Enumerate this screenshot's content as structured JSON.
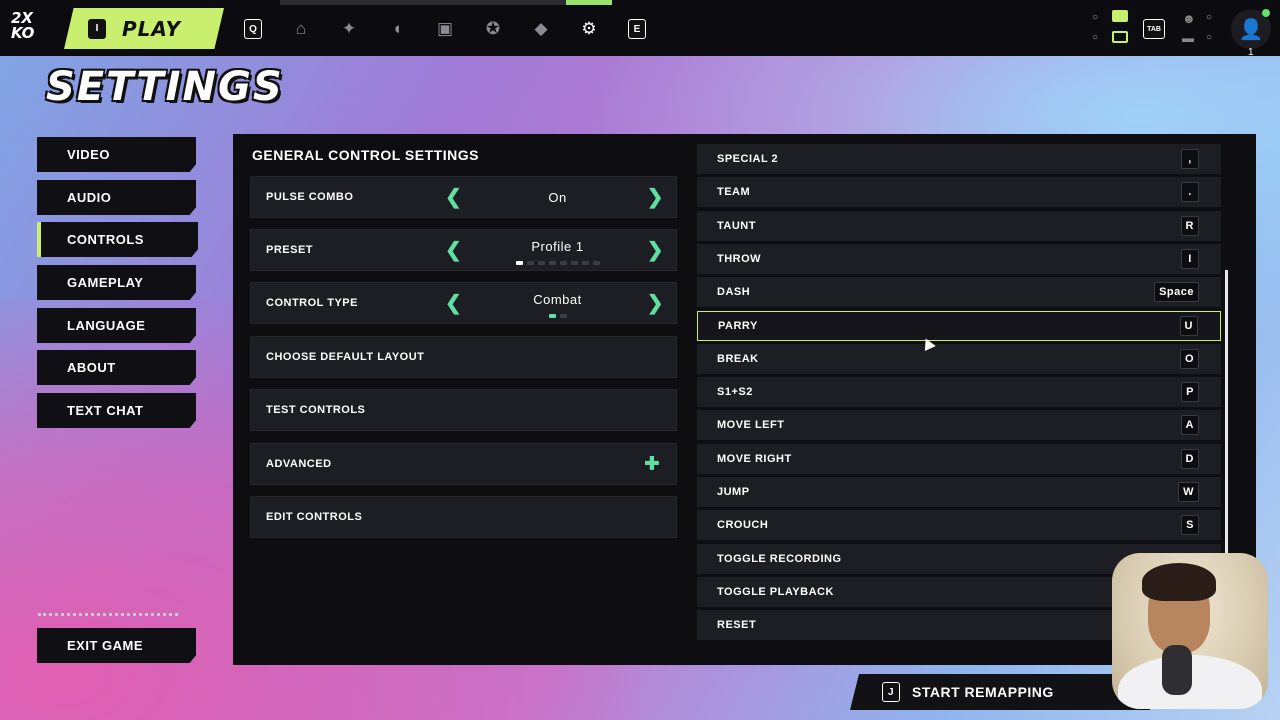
{
  "topbar": {
    "logo_text": "2X KO",
    "play_key": "I",
    "play_label": "PLAY",
    "nav_left_key": "Q",
    "nav_right_key": "E",
    "tab_key": "TAB",
    "avatar_count": "1",
    "nav_icons": [
      "store-icon",
      "crosshair-icon",
      "helmet-icon",
      "backpack-icon",
      "medal-icon",
      "graduation-cap-icon",
      "gear-icon"
    ]
  },
  "page_title": "SETTINGS",
  "sidebar": {
    "items": [
      {
        "label": "VIDEO"
      },
      {
        "label": "AUDIO"
      },
      {
        "label": "CONTROLS",
        "active": true
      },
      {
        "label": "GAMEPLAY"
      },
      {
        "label": "LANGUAGE"
      },
      {
        "label": "ABOUT"
      },
      {
        "label": "TEXT CHAT"
      }
    ],
    "exit_label": "EXIT GAME"
  },
  "general": {
    "title": "GENERAL CONTROL SETTINGS",
    "pulse_combo": {
      "label": "PULSE COMBO",
      "value": "On"
    },
    "preset": {
      "label": "PRESET",
      "value": "Profile 1",
      "page": 1,
      "pages": 8
    },
    "control_type": {
      "label": "CONTROL TYPE",
      "value": "Combat",
      "page": 1,
      "pages": 2
    },
    "choose_default_layout": "CHOOSE DEFAULT LAYOUT",
    "test_controls": "TEST CONTROLS",
    "advanced": "ADVANCED",
    "edit_controls": "EDIT CONTROLS"
  },
  "bindings": [
    {
      "action": "SPECIAL 2",
      "key": ","
    },
    {
      "action": "TEAM",
      "key": "."
    },
    {
      "action": "TAUNT",
      "key": "R"
    },
    {
      "action": "THROW",
      "key": "I"
    },
    {
      "action": "DASH",
      "key": "Space"
    },
    {
      "action": "PARRY",
      "key": "U",
      "selected": true
    },
    {
      "action": "BREAK",
      "key": "O"
    },
    {
      "action": "S1+S2",
      "key": "P"
    },
    {
      "action": "MOVE LEFT",
      "key": "A"
    },
    {
      "action": "MOVE RIGHT",
      "key": "D"
    },
    {
      "action": "JUMP",
      "key": "W"
    },
    {
      "action": "CROUCH",
      "key": "S"
    },
    {
      "action": "TOGGLE RECORDING",
      "key": ""
    },
    {
      "action": "TOGGLE PLAYBACK",
      "key": ""
    },
    {
      "action": "RESET",
      "key": ""
    }
  ],
  "remap": {
    "key": "J",
    "label": "START REMAPPING"
  },
  "colors": {
    "accent": "#c8f06e",
    "arrow": "#5fe0a2",
    "panel": "#0e0e12",
    "row": "#1d1d24"
  }
}
